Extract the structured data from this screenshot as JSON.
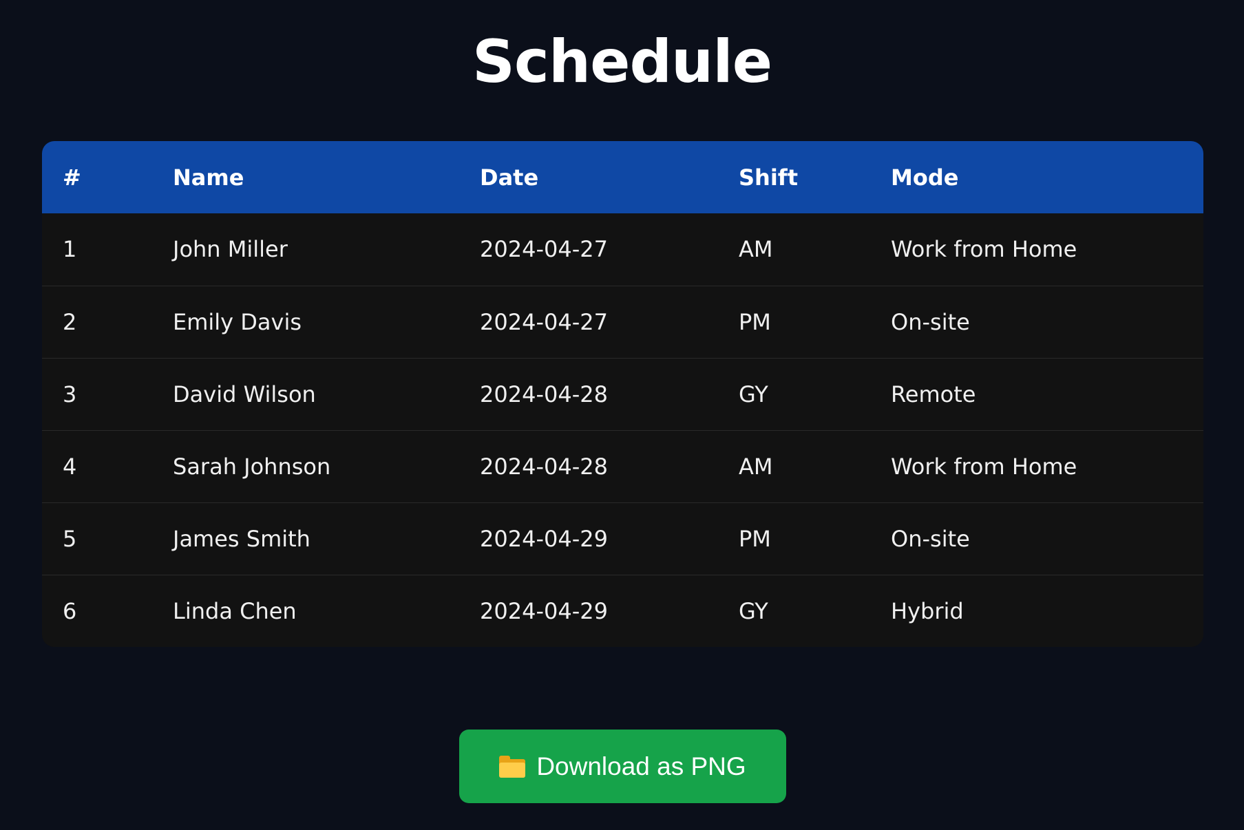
{
  "page": {
    "title": "Schedule"
  },
  "table": {
    "headers": {
      "num": "#",
      "name": "Name",
      "date": "Date",
      "shift": "Shift",
      "mode": "Mode"
    },
    "rows": [
      {
        "num": "1",
        "name": "John Miller",
        "date": "2024-04-27",
        "shift": "AM",
        "mode": "Work from Home"
      },
      {
        "num": "2",
        "name": "Emily Davis",
        "date": "2024-04-27",
        "shift": "PM",
        "mode": "On-site"
      },
      {
        "num": "3",
        "name": "David Wilson",
        "date": "2024-04-28",
        "shift": "GY",
        "mode": "Remote"
      },
      {
        "num": "4",
        "name": "Sarah Johnson",
        "date": "2024-04-28",
        "shift": "AM",
        "mode": "Work from Home"
      },
      {
        "num": "5",
        "name": "James Smith",
        "date": "2024-04-29",
        "shift": "PM",
        "mode": "On-site"
      },
      {
        "num": "6",
        "name": "Linda Chen",
        "date": "2024-04-29",
        "shift": "GY",
        "mode": "Hybrid"
      }
    ]
  },
  "download": {
    "label": "Download as PNG",
    "icon": "folder-icon"
  },
  "colors": {
    "background": "#0b0f1a",
    "header": "#0f48a5",
    "row": "#121212",
    "button": "#16a34a"
  }
}
